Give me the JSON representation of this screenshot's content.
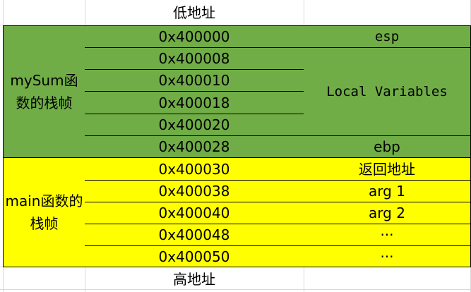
{
  "top_label": "低地址",
  "bottom_label": "高地址",
  "frames": [
    {
      "label": "mySum函数的栈帧",
      "color": "#70ad47"
    },
    {
      "label": "main函数的栈帧",
      "color": "#ffff00"
    }
  ],
  "addresses": [
    "0x400000",
    "0x400008",
    "0x400010",
    "0x400018",
    "0x400020",
    "0x400028",
    "0x400030",
    "0x400038",
    "0x400040",
    "0x400048",
    "0x400050"
  ],
  "contents": {
    "esp": "esp",
    "local_variables": "Local Variables",
    "ebp": "ebp",
    "return_address": "返回地址",
    "arg1": "arg 1",
    "arg2": "arg 2",
    "ellipsis1": "···",
    "ellipsis2": "···"
  }
}
